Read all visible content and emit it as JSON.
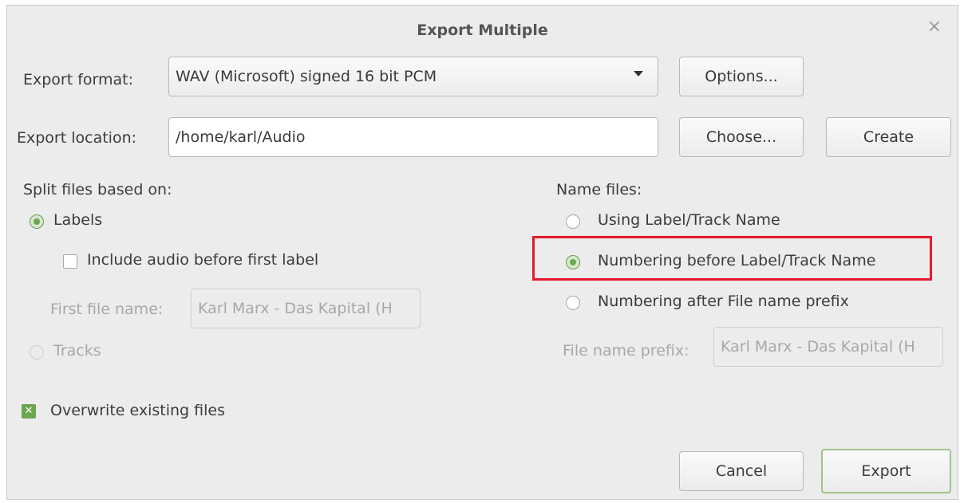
{
  "window": {
    "title": "Export Multiple",
    "close_glyph": "×"
  },
  "format": {
    "label": "Export format:",
    "value": "WAV (Microsoft) signed 16 bit PCM",
    "options_button": "Options..."
  },
  "location": {
    "label": "Export location:",
    "value": "/home/karl/Audio",
    "choose_button": "Choose...",
    "create_button": "Create"
  },
  "split": {
    "heading": "Split files based on:",
    "labels_option": "Labels",
    "include_audio": "Include audio before first label",
    "first_file_label": "First file name:",
    "first_file_value": "Karl Marx - Das Kapital (H",
    "tracks_option": "Tracks"
  },
  "naming": {
    "heading": "Name files:",
    "option_label_track": "Using Label/Track Name",
    "option_numbering_before": "Numbering before Label/Track Name",
    "option_numbering_after": "Numbering after File name prefix",
    "prefix_label": "File name prefix:",
    "prefix_value": "Karl Marx - Das Kapital (H"
  },
  "overwrite": {
    "label": "Overwrite existing files",
    "check_glyph": "✕"
  },
  "footer": {
    "cancel": "Cancel",
    "export": "Export"
  },
  "colors": {
    "accent_green": "#6aa84f",
    "highlight_red": "#e8192c",
    "background": "#ececec"
  }
}
